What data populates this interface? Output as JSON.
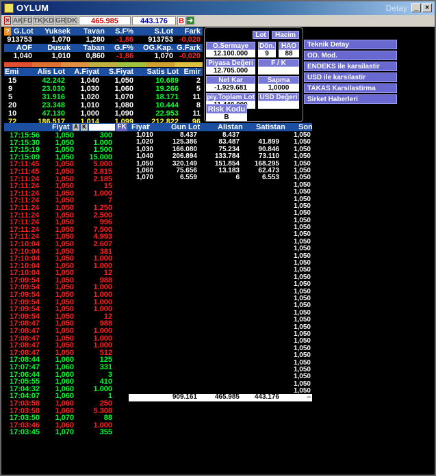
{
  "window": {
    "title": "OYLUM",
    "subtitle": "Detay"
  },
  "toolbar": {
    "buttons": [
      "AK",
      "FD",
      "TK",
      "KD",
      "GR",
      "DK"
    ],
    "value1": "465.985",
    "value2": "443.176",
    "b_label": "B"
  },
  "summary": {
    "h1": [
      "G.Lot",
      "Yuksek",
      "Tavan",
      "S.F%",
      "S.Lot",
      "Fark"
    ],
    "r1": [
      "913753",
      "1,070",
      "1,280",
      "-1,86",
      "913753",
      "-0,020"
    ],
    "h2": [
      "AOF",
      "Dusuk",
      "Taban",
      "G.F%",
      "OG.Kap.",
      "G.Fark"
    ],
    "r2": [
      "1,040",
      "1,010",
      "0,860",
      "-1,86",
      "1,070",
      "-0,020"
    ]
  },
  "depth": {
    "headers": [
      "Emir",
      "Alis Lot",
      "A.Fiyat",
      "S.Fiyat",
      "Satis Lot",
      "Emir"
    ],
    "rows": [
      [
        "15",
        "42.242",
        "1,040",
        "1,050",
        "10.689",
        "2"
      ],
      [
        "9",
        "23.030",
        "1,030",
        "1,060",
        "19.266",
        "5"
      ],
      [
        "5",
        "31.916",
        "1,020",
        "1,070",
        "18.171",
        "11"
      ],
      [
        "20",
        "23.348",
        "1,010",
        "1,080",
        "10.444",
        "8"
      ],
      [
        "10",
        "47.130",
        "1,000",
        "1,090",
        "22.953",
        "11"
      ],
      [
        "72",
        "186.517",
        "1,014",
        "1,099",
        "212.822",
        "96"
      ]
    ]
  },
  "panel": {
    "lot": "Lot",
    "hacim": "Hacim",
    "o_sermaye": "O.Sermaye",
    "o_sermaye_val": "12.100.000",
    "don": "Dön.",
    "don_val": "9",
    "hao": "HAO",
    "hao_val": "88",
    "piyasa": "Piyasa Değeri",
    "piyasa_val": "12.705.000",
    "fk": "F / K",
    "fk_val": "",
    "net_kar": "Net Kar",
    "net_kar_val": "-1.929.681",
    "sapma": "Sapma",
    "sapma_val": "1,0000",
    "piy_toplam": "piy.Toplam Lot",
    "piy_toplam_val": "11.440.000",
    "usd": "USD Değeri",
    "usd_val": "",
    "risk": "Risk Kodu",
    "risk_val": "B"
  },
  "menu": [
    "Teknik Detay",
    "OD. Mod.",
    "ENDEKS ile karsilastir",
    "USD ile karsilastir",
    "TAKAS Karsilastirma",
    "Sirket Haberleri"
  ],
  "trades": {
    "headers": [
      "Fiyat",
      "A",
      "K",
      "FK"
    ],
    "rows": [
      [
        "17:15:56",
        "1,050",
        "300",
        "g"
      ],
      [
        "17:15:30",
        "1,050",
        "1.000",
        "g"
      ],
      [
        "17:15:19",
        "1,050",
        "1.500",
        "g"
      ],
      [
        "17:15:09",
        "1,050",
        "15.000",
        "g"
      ],
      [
        "17:11:45",
        "1,050",
        "5.000",
        "r"
      ],
      [
        "17:11:45",
        "1,050",
        "2.815",
        "r"
      ],
      [
        "17:11:24",
        "1,050",
        "2.185",
        "r"
      ],
      [
        "17:11:24",
        "1,050",
        "15",
        "r"
      ],
      [
        "17:11:24",
        "1,050",
        "1.000",
        "r"
      ],
      [
        "17:11:24",
        "1,050",
        "7",
        "r"
      ],
      [
        "17:11:24",
        "1,050",
        "1.250",
        "r"
      ],
      [
        "17:11:24",
        "1,050",
        "2.500",
        "r"
      ],
      [
        "17:11:24",
        "1,050",
        "996",
        "r"
      ],
      [
        "17:11:24",
        "1,050",
        "7.500",
        "r"
      ],
      [
        "17:11:24",
        "1,050",
        "4.993",
        "r"
      ],
      [
        "17:10:04",
        "1,050",
        "2.607",
        "r"
      ],
      [
        "17:10:04",
        "1,050",
        "381",
        "r"
      ],
      [
        "17:10:04",
        "1,050",
        "1.000",
        "r"
      ],
      [
        "17:10:04",
        "1,050",
        "1.000",
        "r"
      ],
      [
        "17:10:04",
        "1,050",
        "12",
        "r"
      ],
      [
        "17:09:54",
        "1,050",
        "988",
        "r"
      ],
      [
        "17:09:54",
        "1,050",
        "1.000",
        "r"
      ],
      [
        "17:09:54",
        "1,050",
        "1.000",
        "r"
      ],
      [
        "17:09:54",
        "1,050",
        "1.000",
        "r"
      ],
      [
        "17:09:54",
        "1,050",
        "1.000",
        "r"
      ],
      [
        "17:09:54",
        "1,050",
        "12",
        "r"
      ],
      [
        "17:08:47",
        "1,050",
        "988",
        "r"
      ],
      [
        "17:08:47",
        "1,050",
        "1.000",
        "r"
      ],
      [
        "17:08:47",
        "1,050",
        "1.000",
        "r"
      ],
      [
        "17:08:47",
        "1,050",
        "1.000",
        "r"
      ],
      [
        "17:08:47",
        "1,050",
        "512",
        "r"
      ],
      [
        "17:08:44",
        "1,060",
        "125",
        "g"
      ],
      [
        "17:07:47",
        "1,060",
        "331",
        "g"
      ],
      [
        "17:06:44",
        "1,060",
        "3",
        "g"
      ],
      [
        "17:05:55",
        "1,060",
        "410",
        "g"
      ],
      [
        "17:04:32",
        "1,060",
        "1.000",
        "g"
      ],
      [
        "17:04:07",
        "1,060",
        "1",
        "g"
      ],
      [
        "17:03:58",
        "1,060",
        "250",
        "r"
      ],
      [
        "17:03:58",
        "1,060",
        "5.308",
        "r"
      ],
      [
        "17:03:50",
        "1,070",
        "88",
        "g"
      ],
      [
        "17:03:46",
        "1,060",
        "1.000",
        "r"
      ],
      [
        "17:03:45",
        "1,070",
        "355",
        "g"
      ]
    ]
  },
  "dist": {
    "headers": [
      "Fiyat",
      "Gun Lot",
      "Alistan",
      "Satistan"
    ],
    "rows": [
      [
        "1,010",
        "8.437",
        "8.437",
        ""
      ],
      [
        "1,020",
        "125.386",
        "83.487",
        "41.899"
      ],
      [
        "1,030",
        "166.080",
        "75.234",
        "90.846"
      ],
      [
        "1,040",
        "206.894",
        "133.784",
        "73.110"
      ],
      [
        "1,050",
        "320.149",
        "151.854",
        "168.295"
      ],
      [
        "1,060",
        "75.656",
        "13.183",
        "62.473"
      ],
      [
        "1,070",
        "6.559",
        "6",
        "6.553"
      ]
    ],
    "totals": [
      "",
      "909.161",
      "465.985",
      "443.176"
    ]
  },
  "son": {
    "header": "Son",
    "values": [
      "1,050",
      "1,050",
      "1,050",
      "1,050",
      "1,050",
      "1,050",
      "1,050",
      "1,050",
      "1,050",
      "1,050",
      "1,050",
      "1,050",
      "1,050",
      "1,050",
      "1,050",
      "1,050",
      "1,050",
      "1,050",
      "1,050",
      "1,050",
      "1,050",
      "1,050",
      "1,050",
      "1,050",
      "1,050",
      "1,050",
      "1,050",
      "1,050",
      "1,050",
      "1,050",
      "1,050",
      "1,050",
      "1,050",
      "1,050",
      "1,050",
      "1,050",
      "1,050",
      "1,050"
    ]
  }
}
